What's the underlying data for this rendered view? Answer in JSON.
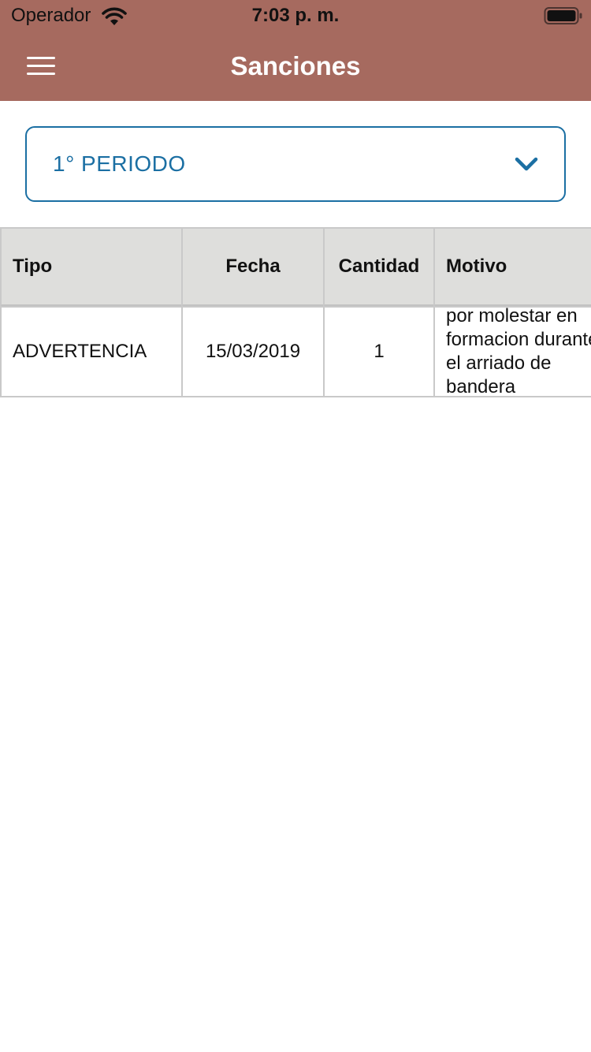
{
  "status_bar": {
    "carrier": "Operador",
    "time": "7:03 p. m."
  },
  "nav_bar": {
    "title": "Sanciones",
    "menu_icon": "hamburger-menu-icon"
  },
  "period_select": {
    "selected": "1° PERIODO",
    "icon": "chevron-down-icon"
  },
  "table": {
    "columns": [
      "Tipo",
      "Fecha",
      "Cantidad",
      "Motivo"
    ],
    "rows": [
      {
        "tipo": "ADVERTENCIA",
        "fecha": "15/03/2019",
        "cantidad": "1",
        "motivo": "por molestar en formacion durante el arriado de bandera"
      }
    ]
  },
  "colors": {
    "header_bg": "#a66a5f",
    "accent": "#1b6fa3",
    "table_header_bg": "#dededc",
    "border": "#c9c9c9"
  }
}
